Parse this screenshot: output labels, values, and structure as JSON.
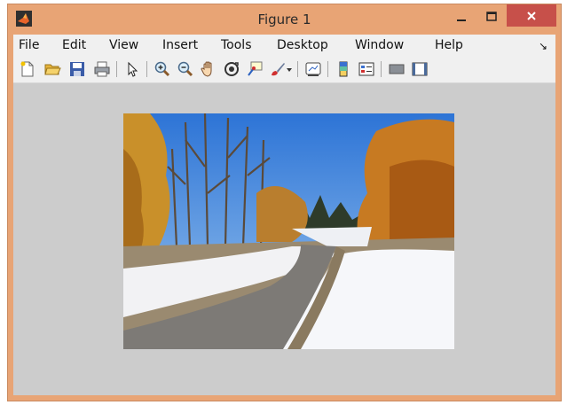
{
  "window": {
    "title": "Figure 1"
  },
  "menu": {
    "items": [
      "File",
      "Edit",
      "View",
      "Insert",
      "Tools",
      "Desktop",
      "Window",
      "Help"
    ],
    "overflow_glyph": "↘"
  },
  "toolbar": {
    "tools": [
      "new-figure-icon",
      "open-file-icon",
      "save-icon",
      "print-icon",
      "pointer-icon",
      "zoom-in-icon",
      "zoom-out-icon",
      "pan-hand-icon",
      "rotate-3d-icon",
      "data-cursor-icon",
      "brush-icon",
      "brush-dropdown-icon",
      "link-plot-icon",
      "colorbar-icon",
      "legend-icon",
      "hide-plot-tools-icon",
      "show-plot-tools-icon"
    ]
  },
  "colors": {
    "chrome": "#e8a475",
    "close": "#c7504a",
    "canvas": "#cccccc",
    "bar": "#f0f0f0"
  }
}
